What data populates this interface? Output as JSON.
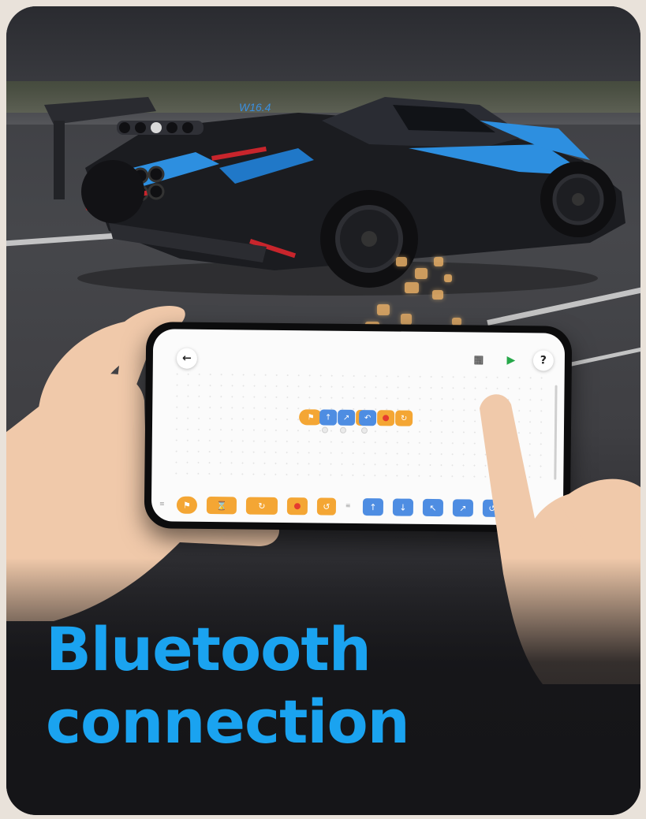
{
  "headline": {
    "line1": "Bluetooth",
    "line2": "connection",
    "color": "#1aa3f0"
  },
  "car": {
    "badge": "W16.4"
  },
  "app_screen": {
    "toolbar": {
      "back_icon": "arrow-left-icon",
      "save_icon": "save-icon",
      "run_icon": "play-icon",
      "help_label": "?"
    },
    "program_blocks": [
      {
        "color": "orange",
        "icon": "flag-icon"
      },
      {
        "color": "blue",
        "icon": "arrow-up-icon"
      },
      {
        "color": "blue",
        "icon": "turn-icon"
      },
      {
        "color": "blue",
        "icon": "turn-back-icon"
      },
      {
        "color": "orange",
        "icon": "stop-icon"
      },
      {
        "color": "orange",
        "icon": "repeat-icon"
      }
    ],
    "palette_blocks": [
      {
        "color": "orange",
        "icon": "flag-icon"
      },
      {
        "color": "orange",
        "icon": "wait-icon"
      },
      {
        "color": "orange",
        "icon": "repeat-icon"
      },
      {
        "color": "orange",
        "icon": "stop-icon"
      },
      {
        "color": "orange",
        "icon": "loop-icon"
      },
      {
        "color": "blue",
        "icon": "arrow-up-icon"
      },
      {
        "color": "blue",
        "icon": "arrow-down-icon"
      },
      {
        "color": "blue",
        "icon": "turn-left-icon"
      },
      {
        "color": "blue",
        "icon": "turn-right-icon"
      },
      {
        "color": "blue",
        "icon": "spin-icon"
      }
    ],
    "colors": {
      "orange_block": "#f4a634",
      "blue_block": "#4e8de2",
      "run_green": "#27a84a"
    }
  }
}
